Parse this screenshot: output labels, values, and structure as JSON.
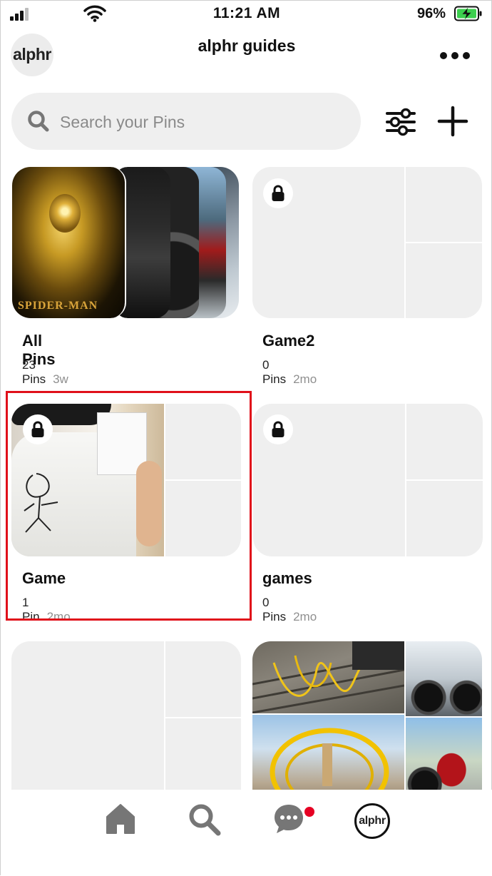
{
  "status_bar": {
    "time": "11:21 AM",
    "battery_percent": "96%",
    "charging": true,
    "signal_bars": 3
  },
  "header": {
    "avatar_text": "alphr",
    "title": "alphr guides",
    "more_icon": "more-dots-icon"
  },
  "search": {
    "placeholder": "Search your Pins",
    "value": ""
  },
  "toolbar": {
    "filter_icon": "sliders-icon",
    "add_icon": "plus-icon"
  },
  "boards": [
    {
      "name": "All Pins",
      "pins": "23 Pins",
      "ago": "3w",
      "locked": false,
      "cover_images": [
        "spider-man-poster",
        "motorcycle",
        "motorcycle",
        "motorcycle",
        "motorcycle"
      ]
    },
    {
      "name": "Game2",
      "pins": "0 Pins",
      "ago": "2mo",
      "locked": true,
      "cover_images": []
    },
    {
      "name": "Game",
      "pins": "1 Pin",
      "ago": "2mo",
      "locked": true,
      "cover_images": [
        "person-drawing-on-wall"
      ]
    },
    {
      "name": "games",
      "pins": "0 Pins",
      "ago": "2mo",
      "locked": true,
      "cover_images": []
    },
    {
      "name": "",
      "locked": false,
      "cover_images": []
    },
    {
      "name": "",
      "locked": false,
      "cover_images": [
        "railway-tracks-yellow-cables",
        "yellow-hoops-street",
        "motorcycle-black",
        "motorcycle-red"
      ]
    }
  ],
  "nav": {
    "home_icon": "home-icon",
    "search_icon": "search-icon",
    "messages_icon": "chat-icon",
    "messages_unread": true,
    "profile_text": "alphr"
  },
  "colors": {
    "highlight": "#e0101a",
    "notification": "#e60023",
    "tile_gray": "#efefef"
  }
}
